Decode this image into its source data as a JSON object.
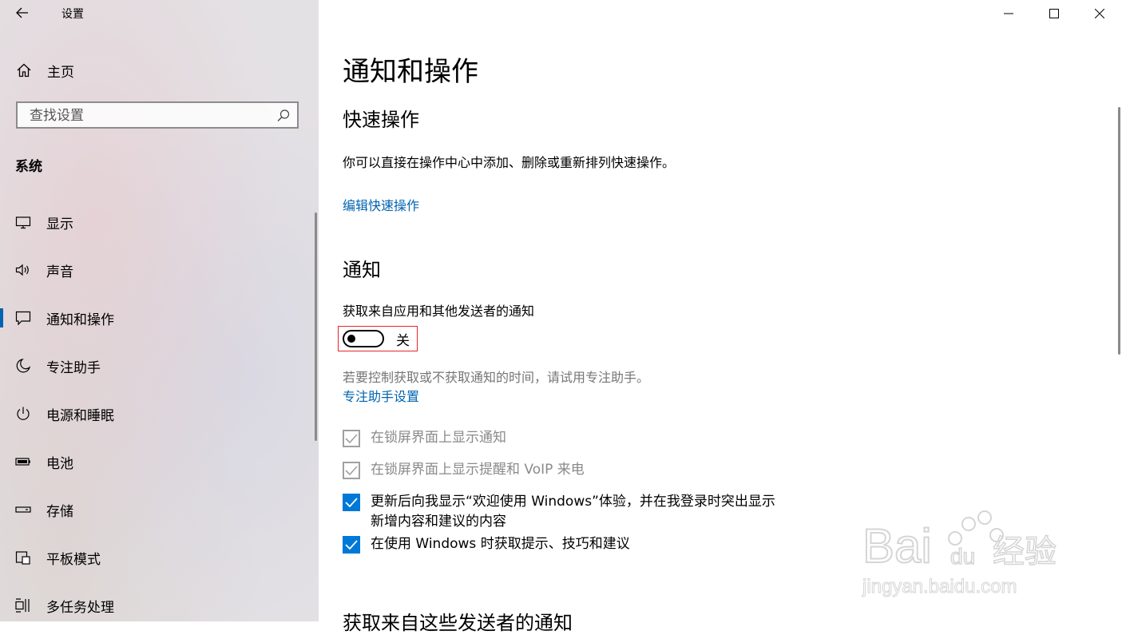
{
  "window": {
    "title": "设置"
  },
  "sidebar": {
    "home_label": "主页",
    "search_placeholder": "查找设置",
    "section_label": "系统",
    "items": [
      {
        "label": "显示",
        "icon": "monitor-icon"
      },
      {
        "label": "声音",
        "icon": "speaker-icon"
      },
      {
        "label": "通知和操作",
        "icon": "notification-icon",
        "active": true
      },
      {
        "label": "专注助手",
        "icon": "moon-icon"
      },
      {
        "label": "电源和睡眠",
        "icon": "power-icon"
      },
      {
        "label": "电池",
        "icon": "battery-icon"
      },
      {
        "label": "存储",
        "icon": "storage-icon"
      },
      {
        "label": "平板模式",
        "icon": "tablet-icon"
      },
      {
        "label": "多任务处理",
        "icon": "multitask-icon"
      }
    ]
  },
  "main": {
    "title": "通知和操作",
    "quick_actions": {
      "heading": "快速操作",
      "description": "你可以直接在操作中心中添加、删除或重新排列快速操作。",
      "edit_link": "编辑快速操作"
    },
    "notifications": {
      "heading": "通知",
      "toggle_caption": "获取来自应用和其他发送者的通知",
      "toggle_state": "关",
      "toggle_on": false,
      "hint": "若要控制获取或不获取通知的时间，请试用专注助手。",
      "focus_link": "专注助手设置",
      "checkboxes": [
        {
          "label": "在锁屏界面上显示通知",
          "checked": true,
          "disabled": true
        },
        {
          "label": "在锁屏界面上显示提醒和 VoIP 来电",
          "checked": true,
          "disabled": true
        },
        {
          "label": "更新后向我显示“欢迎使用 Windows”体验，并在我登录时突出显示",
          "label2": "新增内容和建议的内容",
          "checked": true,
          "disabled": false
        },
        {
          "label": "在使用 Windows 时获取提示、技巧和建议",
          "checked": true,
          "disabled": false
        }
      ]
    },
    "senders_heading": "获取来自这些发送者的通知"
  },
  "watermark": {
    "brand": "Baidu经验",
    "url": "jingyan.baidu.com"
  },
  "colors": {
    "accent": "#0078d7",
    "link": "#0063b1",
    "highlight_box": "#e8242b"
  }
}
